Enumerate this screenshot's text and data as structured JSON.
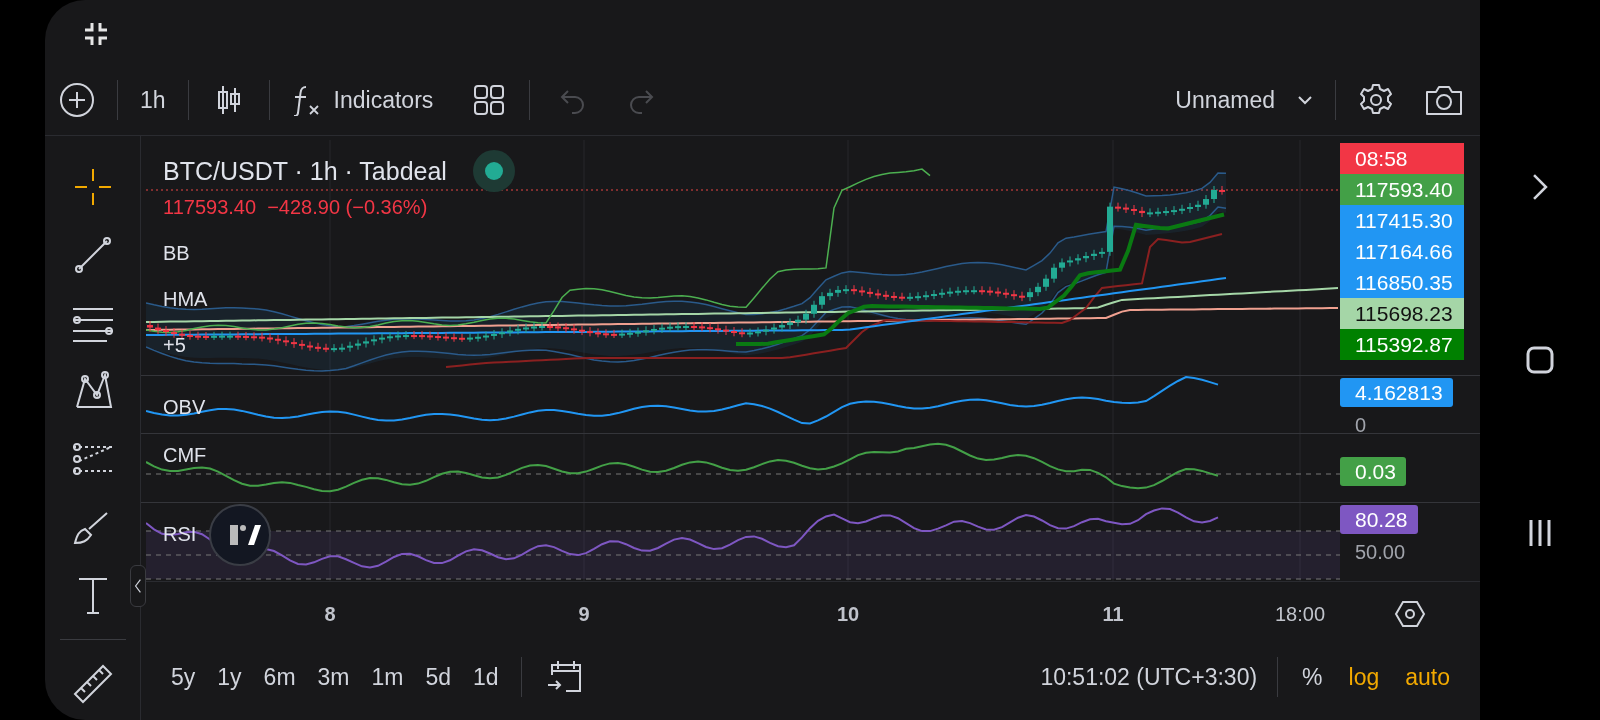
{
  "toolbar": {
    "interval": "1h",
    "indicators_label": "Indicators",
    "undo_disabled": true,
    "redo_disabled": true,
    "layout_name": "Unnamed"
  },
  "drawing_tools": [
    {
      "kind": "crosshair",
      "selected": true
    },
    {
      "kind": "trend-line",
      "selected": false
    },
    {
      "kind": "fib",
      "selected": false
    },
    {
      "kind": "pattern",
      "selected": false
    },
    {
      "kind": "forecast",
      "selected": false
    },
    {
      "kind": "brush",
      "selected": false
    },
    {
      "kind": "text",
      "selected": false
    },
    {
      "kind": "ruler",
      "selected": false
    }
  ],
  "chart": {
    "title": "BTC/USDT · 1h · Tabdeal",
    "last_price": "117593.40",
    "change": "−428.90 (−0.36%)",
    "overlays": [
      "BB",
      "HMA"
    ],
    "more_overlays": "+5",
    "price_tags": [
      {
        "text": "08:58",
        "color": "#f23645"
      },
      {
        "text": "117593.40",
        "color": "#43a047"
      },
      {
        "text": "117415.30",
        "color": "#2196f3"
      },
      {
        "text": "117164.66",
        "color": "#2196f3"
      },
      {
        "text": "116850.35",
        "color": "#2196f3"
      },
      {
        "text": "115698.23",
        "color": "#a5d6a7"
      },
      {
        "text": "115392.87",
        "color": "#008000"
      }
    ],
    "panes": [
      {
        "name": "OBV",
        "tag": {
          "text": "4.162813",
          "color": "#2196f3"
        },
        "axis_label": "0"
      },
      {
        "name": "CMF",
        "tag": {
          "text": "0.03",
          "color": "#43a047"
        }
      },
      {
        "name": "RSI",
        "tag": {
          "text": "80.28",
          "color": "#7e57c2"
        },
        "axis_label": "50.00"
      }
    ],
    "time_labels": [
      "8",
      "9",
      "10",
      "11",
      "18:00"
    ]
  },
  "ranges": [
    "5y",
    "1y",
    "6m",
    "3m",
    "1m",
    "5d",
    "1d"
  ],
  "clock": "10:51:02 (UTC+3:30)",
  "scale_toggles": [
    {
      "label": "%",
      "on": false
    },
    {
      "label": "log",
      "on": true
    },
    {
      "label": "auto",
      "on": true
    }
  ]
}
